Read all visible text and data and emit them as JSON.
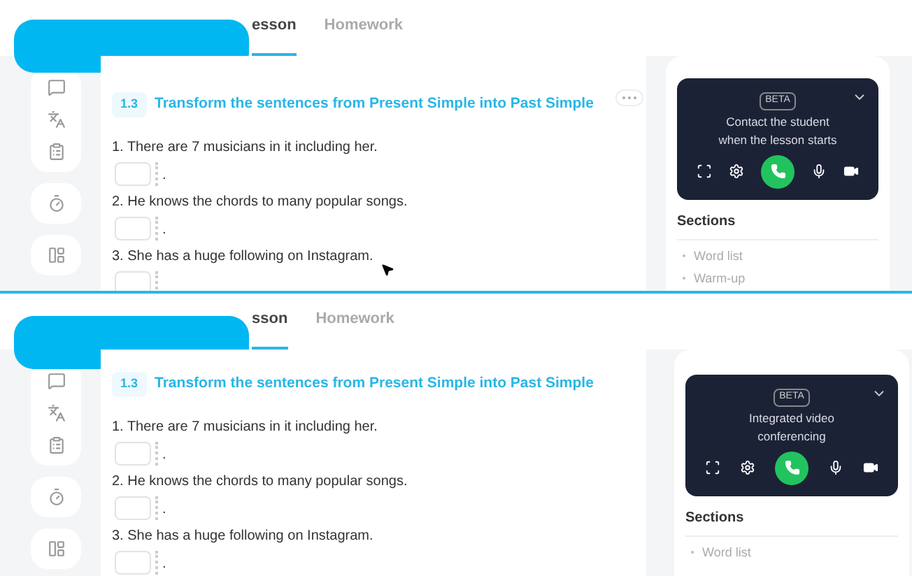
{
  "frames": [
    {
      "tabs": [
        {
          "label": "esson",
          "selected": true
        },
        {
          "label": "Homework",
          "selected": false
        }
      ],
      "exercise": {
        "number": "1.3",
        "title": "Transform the sentences from Present Simple into Past Simple",
        "more_button": true
      },
      "sentences": [
        {
          "text": "1. There are 7 musicians in it including her.",
          "end": "."
        },
        {
          "text": "2. He knows the chords to many popular songs.",
          "end": "."
        },
        {
          "text": "3. She has a huge following on Instagram."
        }
      ],
      "cursor": true,
      "video": {
        "badge": "BETA",
        "lines": [
          "Contact the student",
          "when the lesson starts"
        ]
      },
      "sections": {
        "title": "Sections",
        "items": [
          "Word list",
          "Warm-up"
        ]
      }
    },
    {
      "tabs": [
        {
          "label": "sson",
          "selected": true
        },
        {
          "label": "Homework",
          "selected": false
        }
      ],
      "exercise": {
        "number": "1.3",
        "title": "Transform the sentences from Present Simple into Past Simple",
        "more_button": false
      },
      "sentences": [
        {
          "text": "1. There are 7 musicians in it including her.",
          "end": "."
        },
        {
          "text": "2. He knows the chords to many popular songs.",
          "end": "."
        },
        {
          "text": "3. She has a huge following on Instagram.",
          "end": "."
        }
      ],
      "cursor": false,
      "video": {
        "badge": "BETA",
        "lines": [
          "Integrated video",
          "conferencing"
        ]
      },
      "sections": {
        "title": "Sections",
        "items": [
          "Word list"
        ]
      }
    }
  ]
}
